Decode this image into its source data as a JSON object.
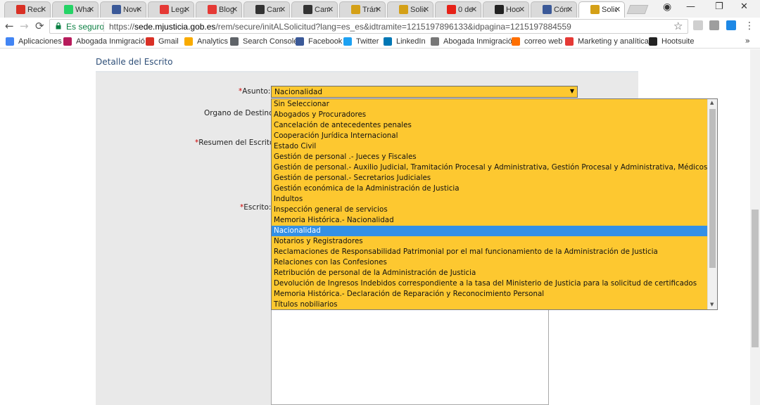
{
  "browser": {
    "tabs": [
      {
        "label": "Recit",
        "icon": "gmail-icon",
        "color": "#d93025"
      },
      {
        "label": "What",
        "icon": "whatsapp-icon",
        "color": "#25d366"
      },
      {
        "label": "Nove",
        "icon": "flag-icon",
        "color": "#3b5998"
      },
      {
        "label": "Lega",
        "icon": "acrobat-icon",
        "color": "#e53935"
      },
      {
        "label": "Blog",
        "icon": "opera-icon",
        "color": "#e53935"
      },
      {
        "label": "Cam",
        "icon": "asterisk-icon",
        "color": "#333333"
      },
      {
        "label": "Cam",
        "icon": "envelope-icon",
        "color": "#333333"
      },
      {
        "label": "Trám",
        "icon": "shield-icon",
        "color": "#d4a017"
      },
      {
        "label": "Solic",
        "icon": "shield-icon",
        "color": "#d4a017"
      },
      {
        "label": "0 de",
        "icon": "youtube-icon",
        "color": "#e62117"
      },
      {
        "label": "Hoo",
        "icon": "hootsuite-icon",
        "color": "#222222"
      },
      {
        "label": "Cóm",
        "icon": "flag-icon",
        "color": "#3b5998"
      },
      {
        "label": "Solic",
        "icon": "shield-icon",
        "color": "#d4a017",
        "active": true
      }
    ],
    "close_glyph": "✕",
    "window": {
      "minimize": "—",
      "restore": "❐",
      "close": "✕"
    },
    "nav": {
      "back": "←",
      "forward": "→",
      "reload": "⟳"
    },
    "secure_label": "Es seguro",
    "url_scheme": "https://",
    "url_host": "sede.mjusticia.gob.es",
    "url_path": "/rem/secure/initALSolicitud?lang=es_es&idtramite=1215197896133&idpagina=1215197884559",
    "star": "☆"
  },
  "bookmarks": {
    "items": [
      {
        "label": "Aplicaciones",
        "icon": "apps-icon",
        "color": "#4285f4"
      },
      {
        "label": "Abogada Inmigració",
        "icon": "bookmark-icon",
        "color": "#b71c5c"
      },
      {
        "label": "Gmail",
        "icon": "gmail-icon",
        "color": "#d93025"
      },
      {
        "label": "Analytics",
        "icon": "analytics-icon",
        "color": "#f9ab00"
      },
      {
        "label": "Search Console",
        "icon": "search-console-icon",
        "color": "#5f6368"
      },
      {
        "label": "Facebook",
        "icon": "facebook-icon",
        "color": "#3b5998"
      },
      {
        "label": "Twitter",
        "icon": "twitter-icon",
        "color": "#1da1f2"
      },
      {
        "label": "LinkedIn",
        "icon": "linkedin-icon",
        "color": "#0077b5"
      },
      {
        "label": "Abogada Inmigración",
        "icon": "page-icon",
        "color": "#777777"
      },
      {
        "label": "correo web",
        "icon": "mail-icon",
        "color": "#ff6f00"
      },
      {
        "label": "Marketing y analítica",
        "icon": "acrobat-icon",
        "color": "#e53935"
      },
      {
        "label": "Hootsuite",
        "icon": "hootsuite-icon",
        "color": "#222222"
      }
    ],
    "more": "»"
  },
  "page": {
    "section_title": "Detalle del Escrito",
    "fields": {
      "asunto_label": "Asunto:",
      "organo_label": "Organo de Destino:",
      "resumen_label": "Resumen del Escrito:",
      "escrito_label": "Escrito:",
      "required_mark": "*"
    },
    "asunto_select": {
      "value": "Nacionalidad",
      "arrow": "▼",
      "options": [
        "Sin Seleccionar",
        "Abogados y Procuradores",
        "Cancelación de antecedentes penales",
        "Cooperación Jurídica Internacional",
        "Estado Civil",
        "Gestión de personal .- Jueces y Fiscales",
        "Gestión de personal.- Auxilio Judicial, Tramitación Procesal y Administrativa, Gestión Procesal y Administrativa, Médicos Forenses",
        "Gestión de personal.- Secretarios Judiciales",
        "Gestión económica de la Administración de Justicia",
        "Indultos",
        "Inspección general de servicios",
        "Memoria Histórica.- Nacionalidad",
        "Nacionalidad",
        "Notarios y Registradores",
        "Reclamaciones de Responsabilidad Patrimonial por el mal funcionamiento de la Administración de Justicia",
        "Relaciones con las Confesiones",
        "Retribución de personal de la Administración de Justicia",
        "Devolución de Ingresos Indebidos correspondiente a la tasa del Ministerio de Justicia para la solicitud de certificados",
        "Memoria Histórica.- Declaración de Reparación y Reconocimiento Personal",
        "Títulos nobiliarios"
      ],
      "selected_index": 12
    },
    "colors": {
      "select_bg": "#fdc830",
      "highlight": "#3390e6",
      "title": "#2d4e77",
      "required": "#cc0000"
    }
  }
}
